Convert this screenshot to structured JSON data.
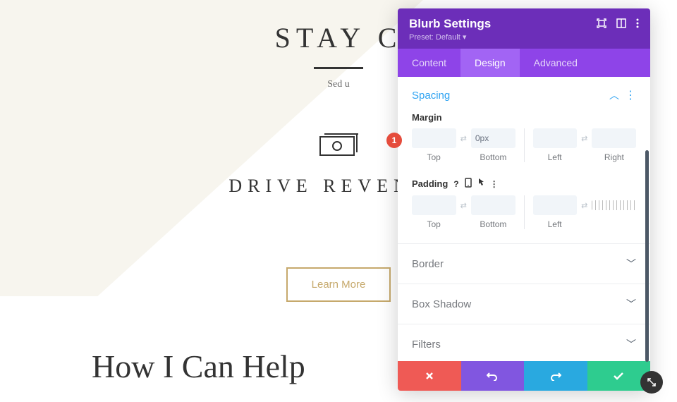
{
  "hero": {
    "title": "STAY C",
    "sub": "Sed u",
    "blurb_title": "DRIVE REVENUE",
    "learn_more": "Learn More",
    "section": "How I Can Help"
  },
  "panel": {
    "title": "Blurb Settings",
    "preset": "Preset: Default ▾",
    "tabs": {
      "content": "Content",
      "design": "Design",
      "advanced": "Advanced"
    }
  },
  "spacing": {
    "title": "Spacing",
    "margin_label": "Margin",
    "padding_label": "Padding",
    "top": "Top",
    "bottom": "Bottom",
    "left": "Left",
    "right": "Right",
    "margin_bottom_value": "0px"
  },
  "accordions": {
    "border": "Border",
    "box_shadow": "Box Shadow",
    "filters": "Filters"
  },
  "callout": "1"
}
